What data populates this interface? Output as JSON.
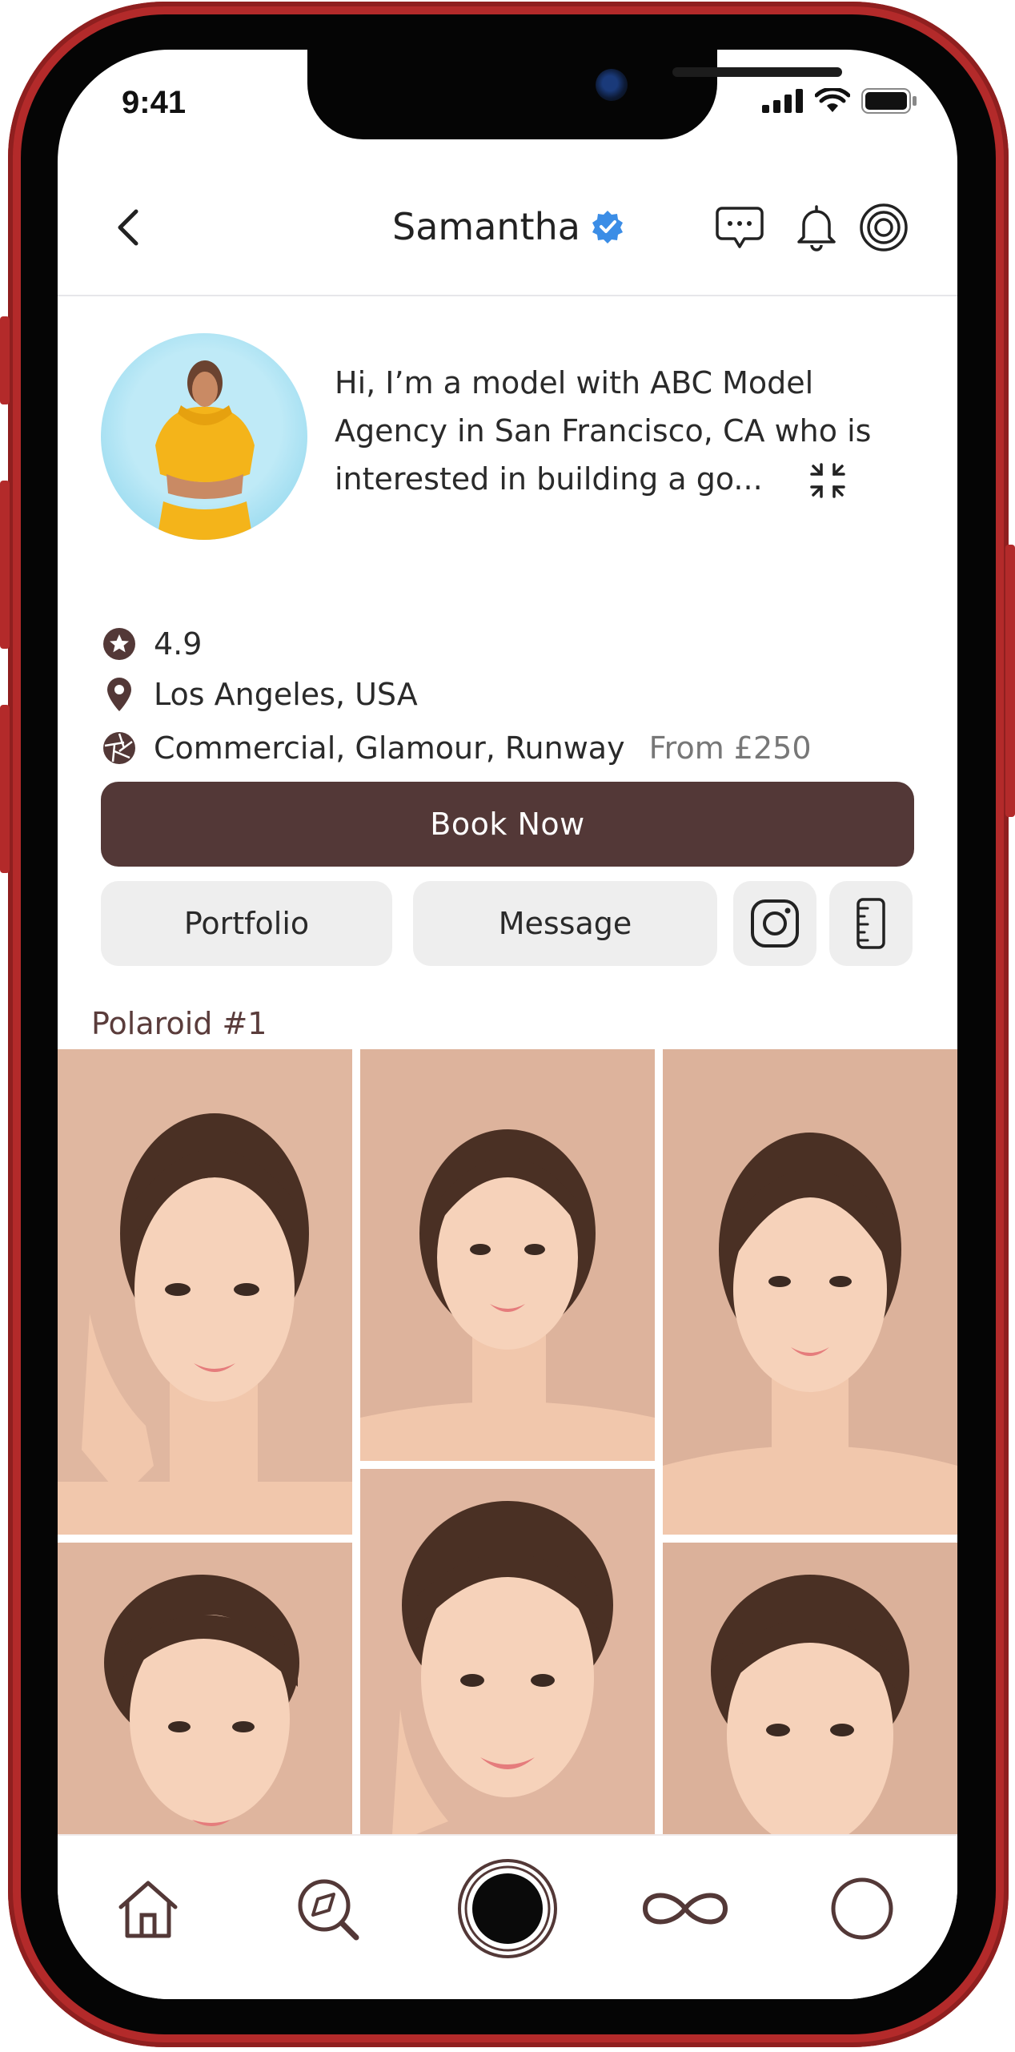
{
  "status_bar": {
    "time": "9:41"
  },
  "header": {
    "title": "Samantha",
    "icons": [
      "back-icon",
      "verified-badge-icon",
      "chat-icon",
      "bell-icon",
      "target-icon"
    ]
  },
  "profile": {
    "bio": "Hi, I’m a model with ABC Model Agency in San Francisco, CA who is interested in building a go...",
    "rating": "4.9",
    "location": "Los Angeles, USA",
    "categories": "Commercial, Glamour, Runway",
    "price": "From £250"
  },
  "actions": {
    "book_label": "Book Now",
    "portfolio_label": "Portfolio",
    "message_label": "Message",
    "icons": [
      "instagram-icon",
      "ruler-icon"
    ]
  },
  "gallery": {
    "section_title": "Polaroid #1"
  },
  "tabbar": {
    "icons": [
      "home-icon",
      "explore-icon",
      "camera-shutter-icon",
      "infinity-icon",
      "profile-circle-icon"
    ]
  },
  "colors": {
    "accent_brown": "#533837",
    "frame_red": "#b32a2a",
    "verified_blue": "#3b8de6",
    "button_gray": "#eeeeee"
  }
}
